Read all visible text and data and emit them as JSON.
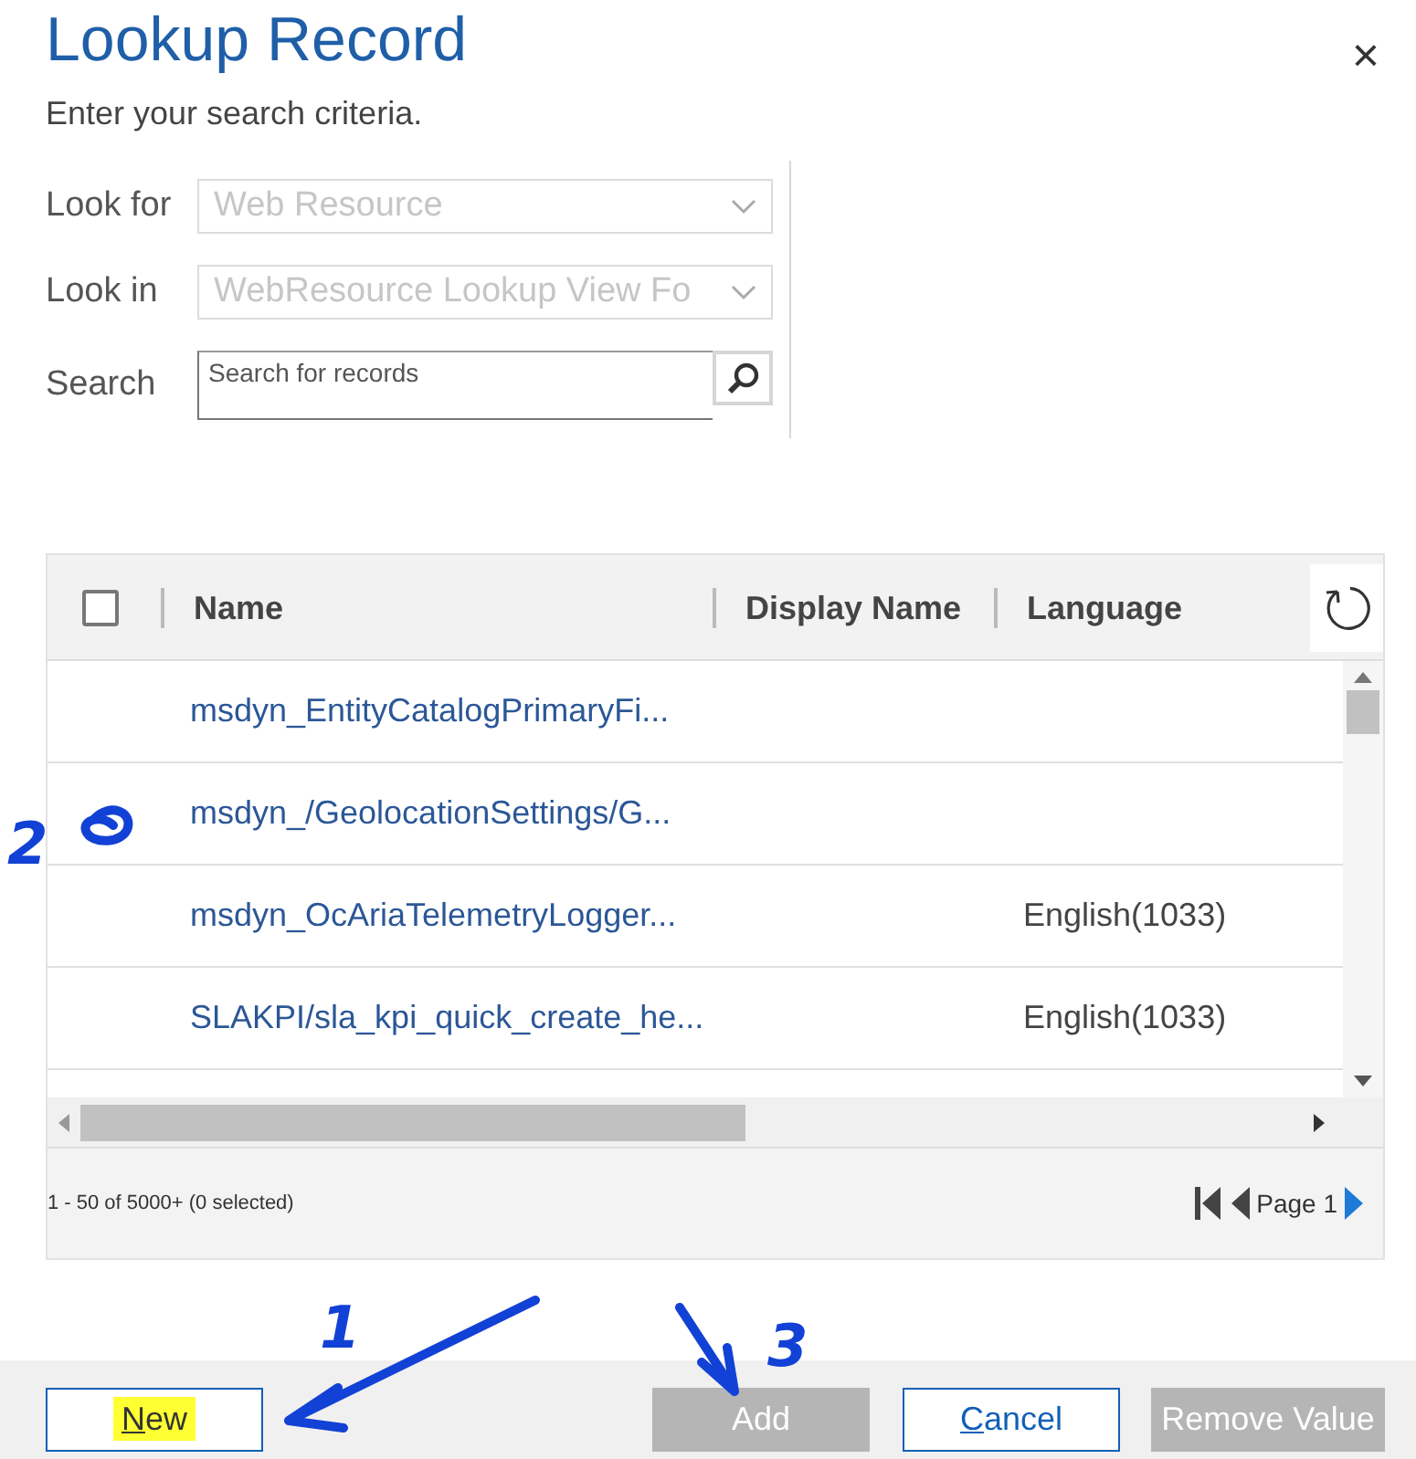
{
  "dialog": {
    "title": "Lookup Record",
    "subtitle": "Enter your search criteria.",
    "close": "×"
  },
  "form": {
    "fields": [
      {
        "kind": "dropdown",
        "label": "Look for",
        "value": "Web Resource",
        "disabled": true
      },
      {
        "kind": "dropdown",
        "label": "Look in",
        "value": "WebResource Lookup View Fo",
        "disabled": true
      },
      {
        "kind": "search",
        "label": "Search",
        "placeholder": "Search for records"
      }
    ]
  },
  "grid": {
    "select_all": {
      "checked": false
    },
    "columns": [
      {
        "label": "Name"
      },
      {
        "label": "Display Name"
      },
      {
        "label": "Language"
      }
    ],
    "rows": [
      {
        "name": "msdyn_EntityCatalogPrimaryFi..."
      },
      {
        "name": "msdyn_/GeolocationSettings/G..."
      },
      {
        "name": "msdyn_OcAriaTelemetryLogger...",
        "language": "English(1033)"
      },
      {
        "name": "SLAKPI/sla_kpi_quick_create_he...",
        "language": "English(1033)"
      }
    ],
    "status": "1 - 50 of 5000+ (0 selected)",
    "pager": {
      "label": "Page 1"
    }
  },
  "buttons": [
    {
      "label": "New",
      "access_key_underlined": true,
      "disabled": false,
      "highlighted": true
    },
    {
      "label": "Add",
      "disabled": true
    },
    {
      "label": "Cancel",
      "access_key_underlined": true,
      "disabled": false
    },
    {
      "label": "Remove Value",
      "disabled": true
    }
  ],
  "annotations": [
    {
      "kind": "label",
      "text": "2"
    },
    {
      "kind": "circle"
    },
    {
      "kind": "label",
      "text": "1"
    },
    {
      "kind": "arrow"
    },
    {
      "kind": "label",
      "text": "3"
    },
    {
      "kind": "arrow"
    }
  ]
}
